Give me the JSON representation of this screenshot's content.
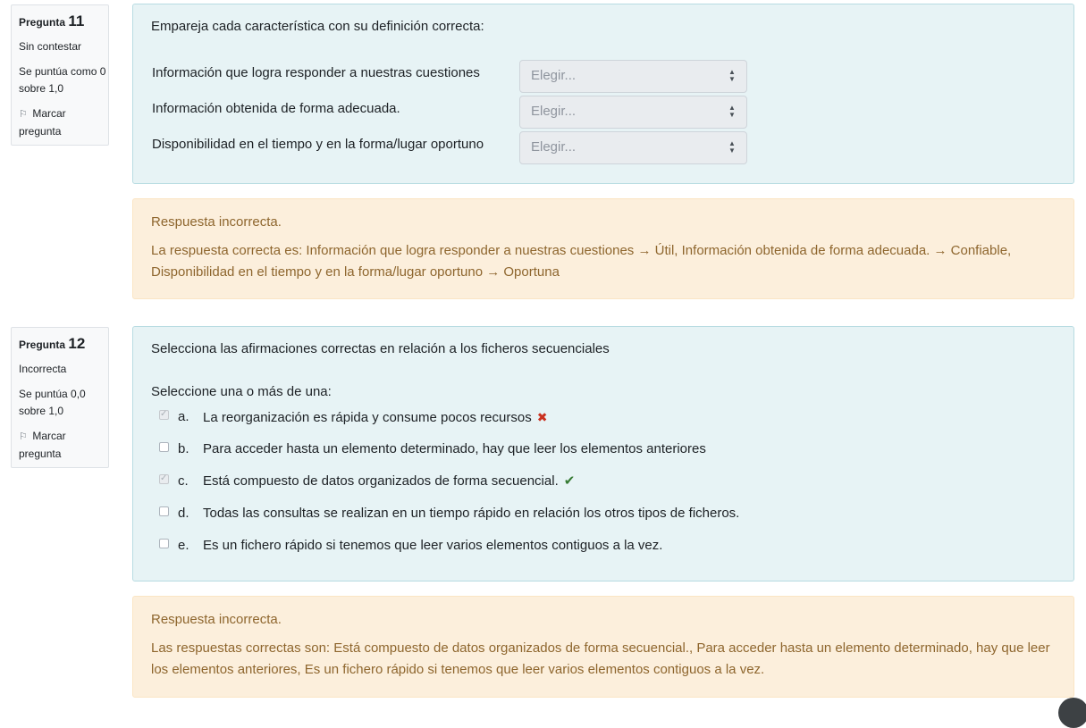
{
  "q11": {
    "label": "Pregunta",
    "number": "11",
    "state": "Sin contestar",
    "grade": "Se puntúa como 0 sobre 1,0",
    "flag": "Marcar pregunta",
    "question": "Empareja cada característica con su definición correcta:",
    "rows": [
      {
        "label": "Información que logra responder a nuestras cuestiones",
        "select": "Elegir..."
      },
      {
        "label": "Información obtenida de forma adecuada.",
        "select": "Elegir..."
      },
      {
        "label": "Disponibilidad en el tiempo y en la forma/lugar oportuno",
        "select": "Elegir..."
      }
    ],
    "feedback_title": "Respuesta incorrecta.",
    "feedback_text": "La respuesta correcta es: Información que logra responder a nuestras cuestiones → Útil, Información obtenida de forma adecuada. → Confiable, Disponibilidad en el tiempo y en la forma/lugar oportuno → Oportuna"
  },
  "q12": {
    "label": "Pregunta",
    "number": "12",
    "state": "Incorrecta",
    "grade": "Se puntúa 0,0 sobre 1,0",
    "flag": "Marcar pregunta",
    "question": "Selecciona las afirmaciones correctas en relación a los ficheros secuenciales",
    "prompt": "Seleccione una o más de una:",
    "answers": [
      {
        "letter": "a.",
        "text": "La reorganización es rápida y consume pocos recursos",
        "checked": true,
        "mark": "wrong"
      },
      {
        "letter": "b.",
        "text": "Para acceder hasta un elemento determinado, hay que leer los elementos anteriores",
        "checked": false,
        "mark": ""
      },
      {
        "letter": "c.",
        "text": "Está compuesto de datos organizados de forma secuencial.",
        "checked": true,
        "mark": "right"
      },
      {
        "letter": "d.",
        "text": "Todas las consultas se realizan en un tiempo rápido en relación los otros tipos de ficheros.",
        "checked": false,
        "mark": ""
      },
      {
        "letter": "e.",
        "text": "Es un fichero rápido si tenemos que leer varios elementos contiguos a la vez.",
        "checked": false,
        "mark": ""
      }
    ],
    "feedback_title": "Respuesta incorrecta.",
    "feedback_text": "Las respuestas correctas son: Está compuesto de datos organizados de forma secuencial., Para acceder hasta un elemento determinado, hay que leer los elementos anteriores, Es un fichero rápido si tenemos que leer varios elementos contiguos a la vez."
  },
  "icons": {
    "flag": "flag-icon",
    "wrong": "cross-icon",
    "right": "check-icon",
    "select_caret": "sort-caret-icon"
  },
  "colors": {
    "formulation_bg": "#e7f3f5",
    "feedback_bg": "#fcefdc",
    "feedback_text": "#8e662e",
    "wrong": "#ca3120",
    "right": "#357a32"
  }
}
